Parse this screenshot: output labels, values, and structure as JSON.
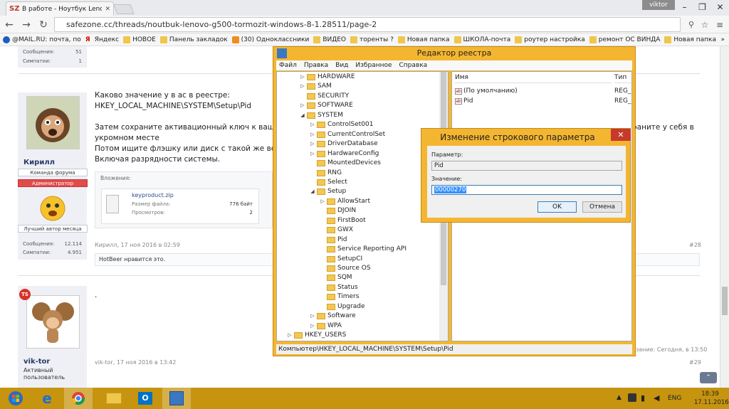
{
  "browser": {
    "tab_title": "В работе - Ноутбук Lenovo",
    "favicon": "SZ",
    "user": "viktor",
    "url": "safezone.cc/threads/noutbuk-lenovo-g500-tormozit-windows-8-1.28511/page-2"
  },
  "bookmarks": [
    {
      "label": "@MAIL.RU: почта, по",
      "icon": "mail-icon"
    },
    {
      "label": "Яндекс",
      "icon": "yandex-icon"
    },
    {
      "label": "НОВОЕ",
      "icon": "folder-icon"
    },
    {
      "label": "Панель закладок",
      "icon": "folder-icon"
    },
    {
      "label": "(30) Одноклассники",
      "icon": "ok-icon"
    },
    {
      "label": "ВИДЕО",
      "icon": "folder-icon"
    },
    {
      "label": "торенты ?",
      "icon": "folder-icon"
    },
    {
      "label": "Новая папка",
      "icon": "folder-icon"
    },
    {
      "label": "ШКОЛА-почта",
      "icon": "folder-icon"
    },
    {
      "label": "роутер настройка",
      "icon": "folder-icon"
    },
    {
      "label": "ремонт ОС ВИНДА",
      "icon": "folder-icon"
    },
    {
      "label": "Новая папка",
      "icon": "folder-icon"
    }
  ],
  "forum": {
    "top_stats": {
      "messages_label": "Сообщения:",
      "messages": "51",
      "likes_label": "Симпатии:",
      "likes": "1"
    },
    "post1": {
      "username": "Кирилл",
      "badge1": "Команда форума",
      "badge2": "Администратор",
      "badge3": "Лучший автор месяца",
      "messages_label": "Сообщения:",
      "messages": "12.114",
      "likes_label": "Симпатии:",
      "likes": "4.951",
      "line1": "Каково значение у в ас в реестре:",
      "line2": "HKEY_LOCAL_MACHINE\\SYSTEM\\Setup\\Pid",
      "line3": "Затем сохраните активационный ключ к вашей с",
      "line3_tail": "раните у себя в",
      "line4": "укромном месте",
      "line5": "Потом ищите флэшку или диск с такой же верси",
      "line6": "Включая разрядности системы.",
      "attachments_label": "Вложения:",
      "file_name": "keyproduct.zip",
      "size_label": "Размер файла:",
      "size": "776 байт",
      "views_label": "Просмотров:",
      "views": "2",
      "footer": "Кирилл, 17 ноя 2016 в 02:59",
      "number": "#28",
      "likes_text": "HotBeer нравится это."
    },
    "post2": {
      "username": "vik-tor",
      "title": "Активный пользователь",
      "body": ".",
      "footer": "vik-tor, 17 ноя 2016 в 13:42",
      "number": "#29",
      "edit_info": "зание: Сегодня, в 13:50"
    }
  },
  "regedit": {
    "title": "Редактор реестра",
    "menu": [
      "Файл",
      "Правка",
      "Вид",
      "Избранное",
      "Справка"
    ],
    "tree": [
      {
        "label": "HARDWARE",
        "level": 0,
        "expander": "▷"
      },
      {
        "label": "SAM",
        "level": 0,
        "expander": "▷"
      },
      {
        "label": "SECURITY",
        "level": 0,
        "expander": ""
      },
      {
        "label": "SOFTWARE",
        "level": 0,
        "expander": "▷"
      },
      {
        "label": "SYSTEM",
        "level": 0,
        "expander": "◢"
      },
      {
        "label": "ControlSet001",
        "level": 1,
        "expander": "▷"
      },
      {
        "label": "CurrentControlSet",
        "level": 1,
        "expander": "▷"
      },
      {
        "label": "DriverDatabase",
        "level": 1,
        "expander": "▷"
      },
      {
        "label": "HardwareConfig",
        "level": 1,
        "expander": "▷"
      },
      {
        "label": "MountedDevices",
        "level": 1,
        "expander": ""
      },
      {
        "label": "RNG",
        "level": 1,
        "expander": ""
      },
      {
        "label": "Select",
        "level": 1,
        "expander": ""
      },
      {
        "label": "Setup",
        "level": 1,
        "expander": "◢"
      },
      {
        "label": "AllowStart",
        "level": 2,
        "expander": "▷"
      },
      {
        "label": "DJOIN",
        "level": 2,
        "expander": ""
      },
      {
        "label": "FirstBoot",
        "level": 2,
        "expander": ""
      },
      {
        "label": "GWX",
        "level": 2,
        "expander": ""
      },
      {
        "label": "Pid",
        "level": 2,
        "expander": ""
      },
      {
        "label": "Service Reporting API",
        "level": 2,
        "expander": ""
      },
      {
        "label": "SetupCI",
        "level": 2,
        "expander": ""
      },
      {
        "label": "Source OS",
        "level": 2,
        "expander": ""
      },
      {
        "label": "SQM",
        "level": 2,
        "expander": ""
      },
      {
        "label": "Status",
        "level": 2,
        "expander": ""
      },
      {
        "label": "Timers",
        "level": 2,
        "expander": ""
      },
      {
        "label": "Upgrade",
        "level": 2,
        "expander": ""
      },
      {
        "label": "Software",
        "level": 1,
        "expander": "▷"
      },
      {
        "label": "WPA",
        "level": 1,
        "expander": "▷"
      },
      {
        "label": "HKEY_USERS",
        "level": -1,
        "expander": "▷"
      }
    ],
    "columns": {
      "name": "Имя",
      "type": "Тип"
    },
    "values": [
      {
        "name": "(По умолчанию)",
        "type": "REG_S"
      },
      {
        "name": "Pid",
        "type": "REG_S"
      }
    ],
    "status": "Компьютер\\HKEY_LOCAL_MACHINE\\SYSTEM\\Setup\\Pid"
  },
  "dialog": {
    "title": "Изменение строкового параметра",
    "close": "✕",
    "param_label": "Параметр:",
    "param_value": "Pid",
    "value_label": "Значение:",
    "value": "00000270",
    "ok": "OK",
    "cancel": "Отмена"
  },
  "taskbar": {
    "time": "18:39",
    "date": "17.11.2016",
    "lang": "ENG"
  }
}
